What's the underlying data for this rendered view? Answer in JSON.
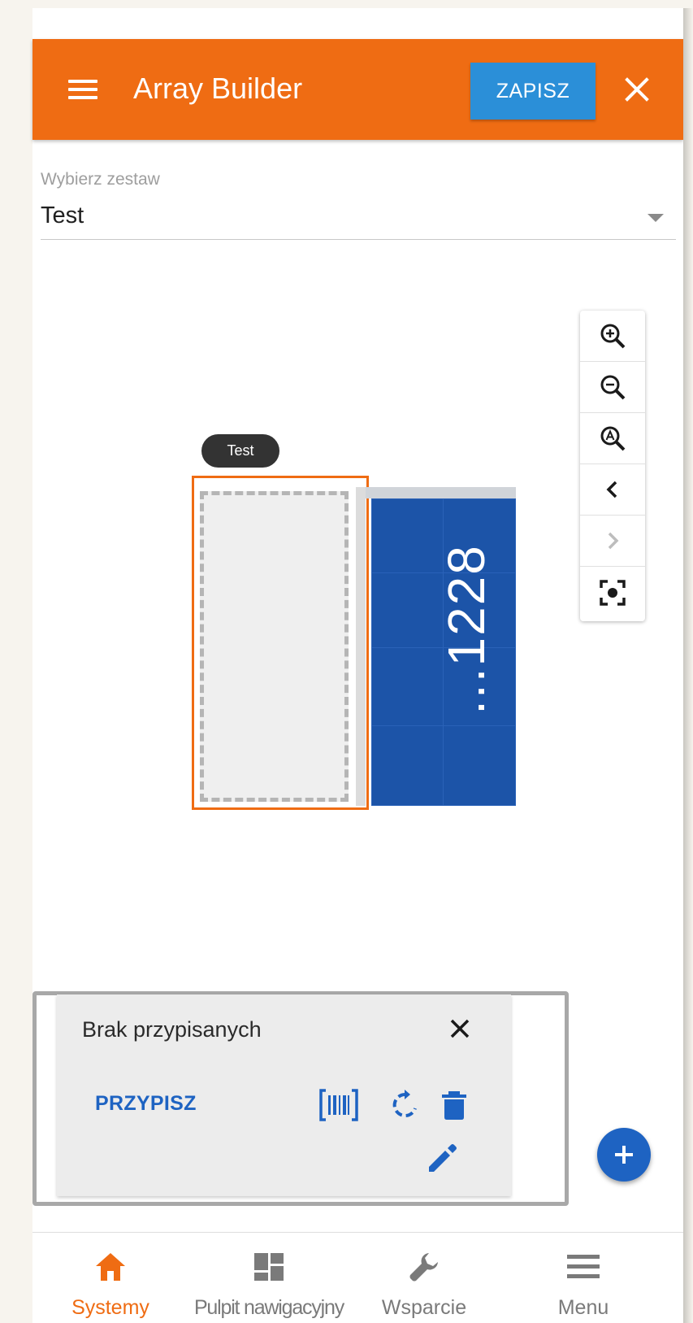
{
  "appbar": {
    "menu_icon": "hamburger-menu-icon",
    "title": "Array Builder",
    "save_label": "ZAPISZ",
    "close_icon": "close-icon"
  },
  "set_select": {
    "label": "Wybierz zestaw",
    "value": "Test"
  },
  "zoom_toolbar": {
    "items": [
      "zoom-in-icon",
      "zoom-out-icon",
      "zoom-auto-icon",
      "chevron-left-icon",
      "chevron-right-icon",
      "center-focus-icon"
    ]
  },
  "canvas": {
    "tooltip": "Test",
    "array_label": "...1228"
  },
  "panel": {
    "title": "Brak przypisanych",
    "assign_label": "PRZYPISZ",
    "icons": [
      "barcode-scan-icon",
      "rotate-icon",
      "delete-icon",
      "edit-pencil-icon"
    ]
  },
  "fab": {
    "icon": "plus-icon"
  },
  "bottom_nav": {
    "items": [
      {
        "label": "Systemy",
        "icon": "home-icon",
        "active": true
      },
      {
        "label": "Pulpit nawigacyjny",
        "icon": "dashboard-icon",
        "active": false
      },
      {
        "label": "Wsparcie",
        "icon": "wrench-icon",
        "active": false
      },
      {
        "label": "Menu",
        "icon": "menu-icon",
        "active": false
      }
    ]
  },
  "colors": {
    "primary": "#ef6c13",
    "save_button": "#2b8fd8",
    "accent_blue": "#1e63c2",
    "array_blue": "#1d56ac"
  }
}
